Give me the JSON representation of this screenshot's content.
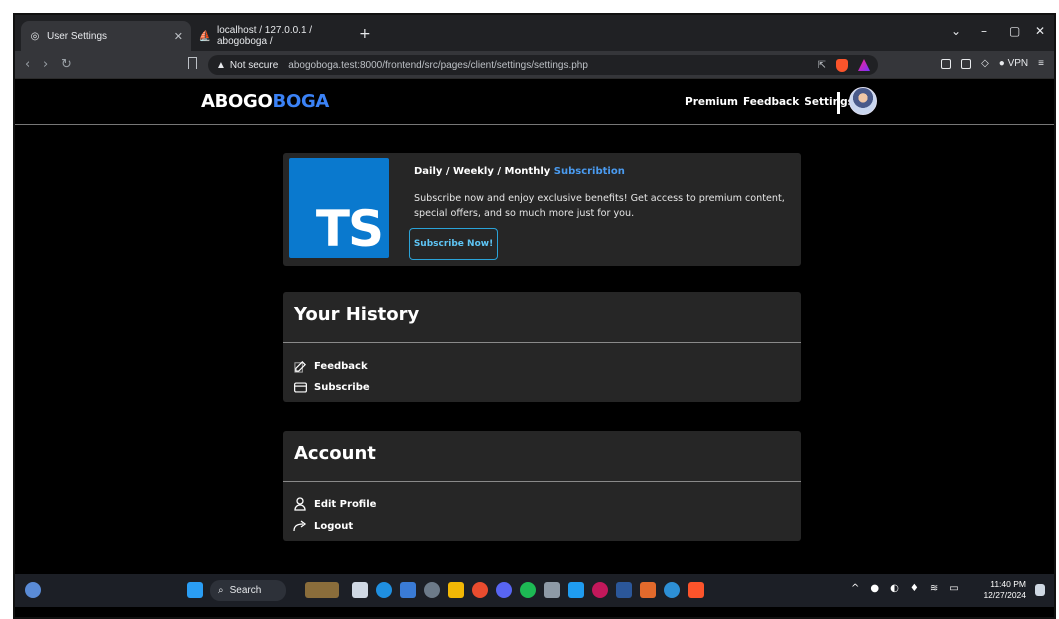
{
  "browser": {
    "tabs": [
      {
        "label": "User Settings",
        "active": true
      },
      {
        "label": "localhost / 127.0.0.1 / abogoboga /",
        "active": false
      }
    ],
    "new_tab": "+",
    "not_secure": "Not secure",
    "url": "abogoboga.test:8000/frontend/src/pages/client/settings/settings.php",
    "vpn_label": "VPN"
  },
  "header": {
    "logo_part1": "ABOGO",
    "logo_part2": "BOGA",
    "nav": [
      "Premium",
      "Feedback",
      "Settings"
    ]
  },
  "promo": {
    "logo_text": "TS",
    "title_prefix": "Daily / Weekly / Monthly",
    "title_highlight": "Subscribtion",
    "description": "Subscribe now and enjoy exclusive benefits! Get access to premium content, special offers, and so much more just for you.",
    "button_label": "Subscribe Now!"
  },
  "history": {
    "title": "Your History",
    "items": [
      {
        "label": "Feedback",
        "icon": "edit-icon"
      },
      {
        "label": "Subscribe",
        "icon": "card-icon"
      }
    ]
  },
  "account": {
    "title": "Account",
    "items": [
      {
        "label": "Edit Profile",
        "icon": "user-icon"
      },
      {
        "label": "Logout",
        "icon": "logout-icon"
      }
    ]
  },
  "taskbar": {
    "search_placeholder": "Search",
    "time": "11:40 PM",
    "date": "12/27/2024"
  },
  "colors": {
    "accent": "#3b82f6",
    "card_bg": "#262626",
    "ts_blue": "#0a79ce"
  }
}
